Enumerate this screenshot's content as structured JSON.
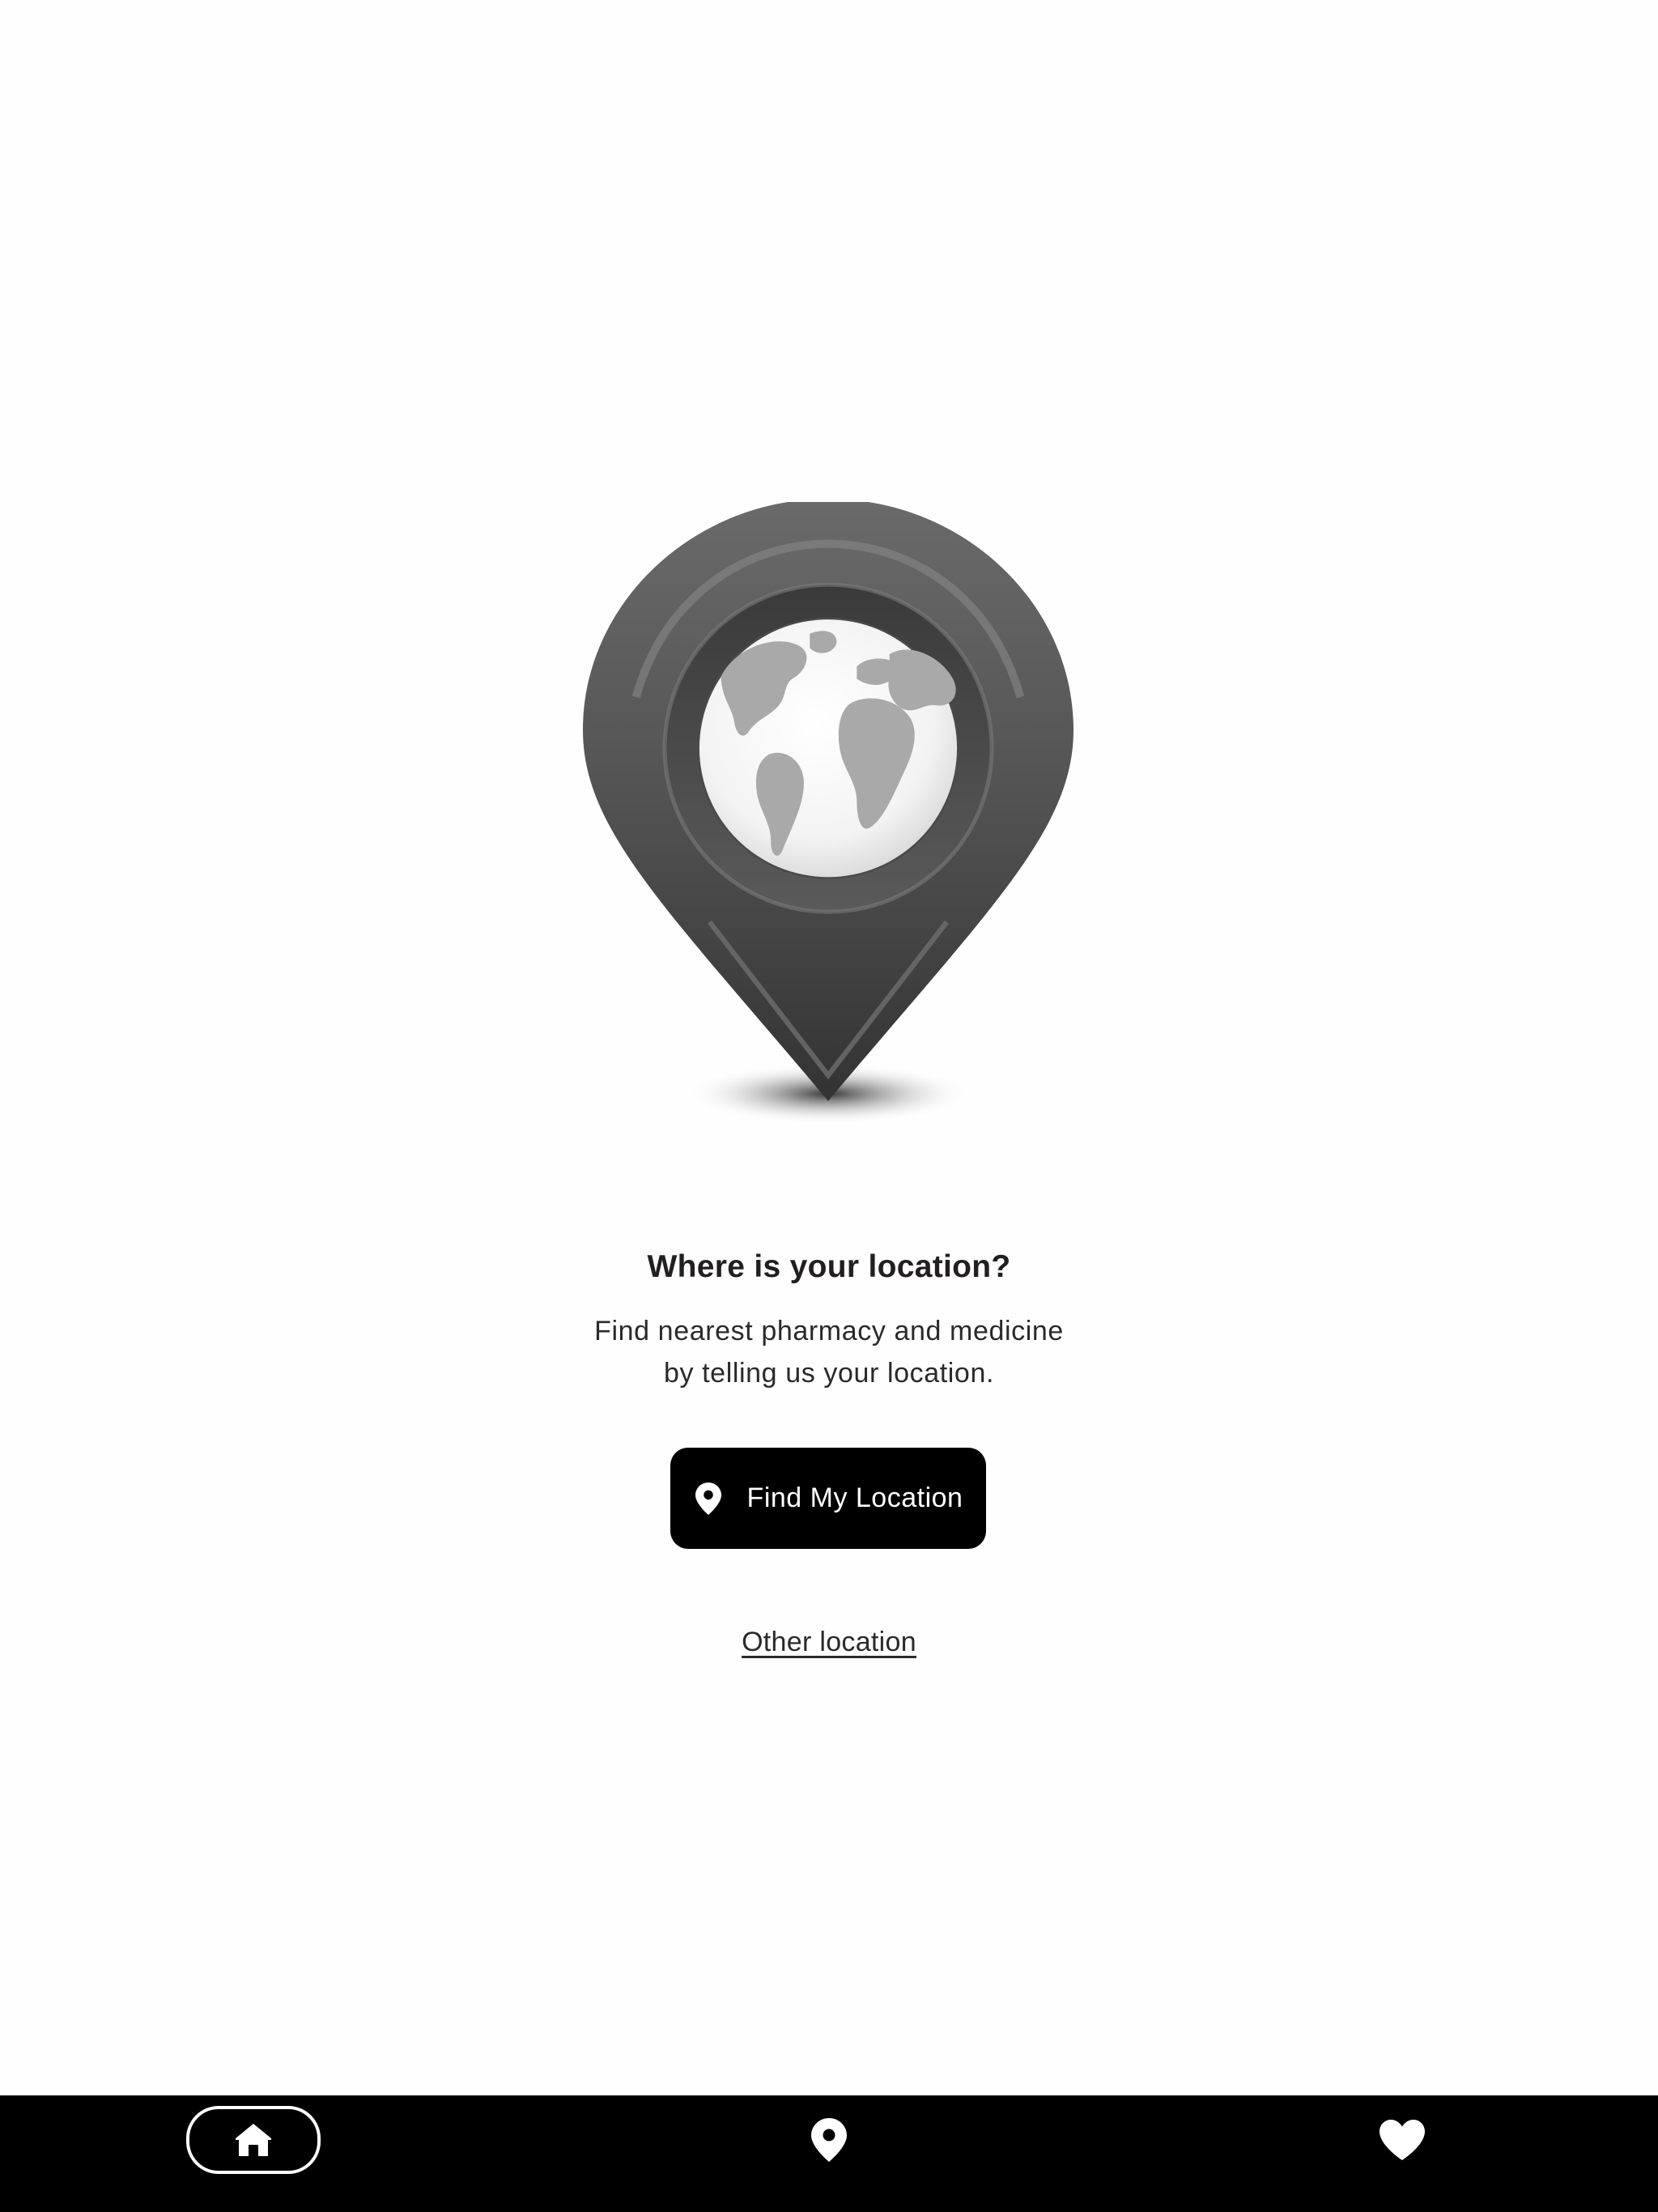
{
  "illustration": {
    "icon": "map-pin-globe-icon",
    "pin_color": "#4d4d4d"
  },
  "main": {
    "title": "Where is your location?",
    "subtitle_line1": "Find nearest pharmacy and medicine",
    "subtitle_line2": "by telling us your location."
  },
  "actions": {
    "find_label": "Find My Location",
    "find_icon": "location-pin-icon",
    "other_label": "Other location"
  },
  "bottom_nav": {
    "items": [
      {
        "icon": "home-icon",
        "active": true
      },
      {
        "icon": "location-pin-icon",
        "active": false
      },
      {
        "icon": "heart-icon",
        "active": false
      }
    ]
  },
  "colors": {
    "background": "#fefefe",
    "button": "#000000",
    "nav_bar": "#000000",
    "text": "#231f20"
  }
}
